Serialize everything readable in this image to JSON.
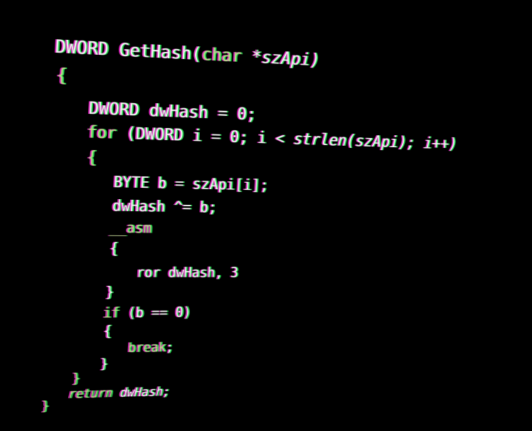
{
  "code": {
    "l1": {
      "ret": "DWORD",
      "name": "GetHash(",
      "ptype": "char",
      "param": " *szApi)"
    },
    "l2": {
      "text": "{"
    },
    "l3": {
      "type": "DWORD",
      "rest": " dwHash = 0;"
    },
    "l4": {
      "kw": "for",
      "a": " (DWORD i = 0; i < ",
      "b": "strlen(szApi); i++)"
    },
    "l5": {
      "text": "{"
    },
    "l6": {
      "text": "BYTE b = szApi[i];"
    },
    "l7": {
      "text": "dwHash ^= b;"
    },
    "l8": {
      "kw": "__asm"
    },
    "l9": {
      "text": "{"
    },
    "l10": {
      "text": "ror dwHash, 3"
    },
    "l11": {
      "text": "}"
    },
    "l12": {
      "kw": "if",
      "rest": " (b == 0)"
    },
    "l13": {
      "text": "{"
    },
    "l14": {
      "kw": "break",
      "rest": ";"
    },
    "l15": {
      "text": "}"
    },
    "l16": {
      "text": "}"
    },
    "l17": {
      "kw": "return",
      "rest": " dwHash;"
    },
    "l18": {
      "text": "}"
    }
  },
  "colors": {
    "background": "#000000",
    "text": "#f2f2f2",
    "keyword": "#b8d98a",
    "fringe_magenta": "#ff28dc",
    "fringe_green": "#28ff5a"
  }
}
